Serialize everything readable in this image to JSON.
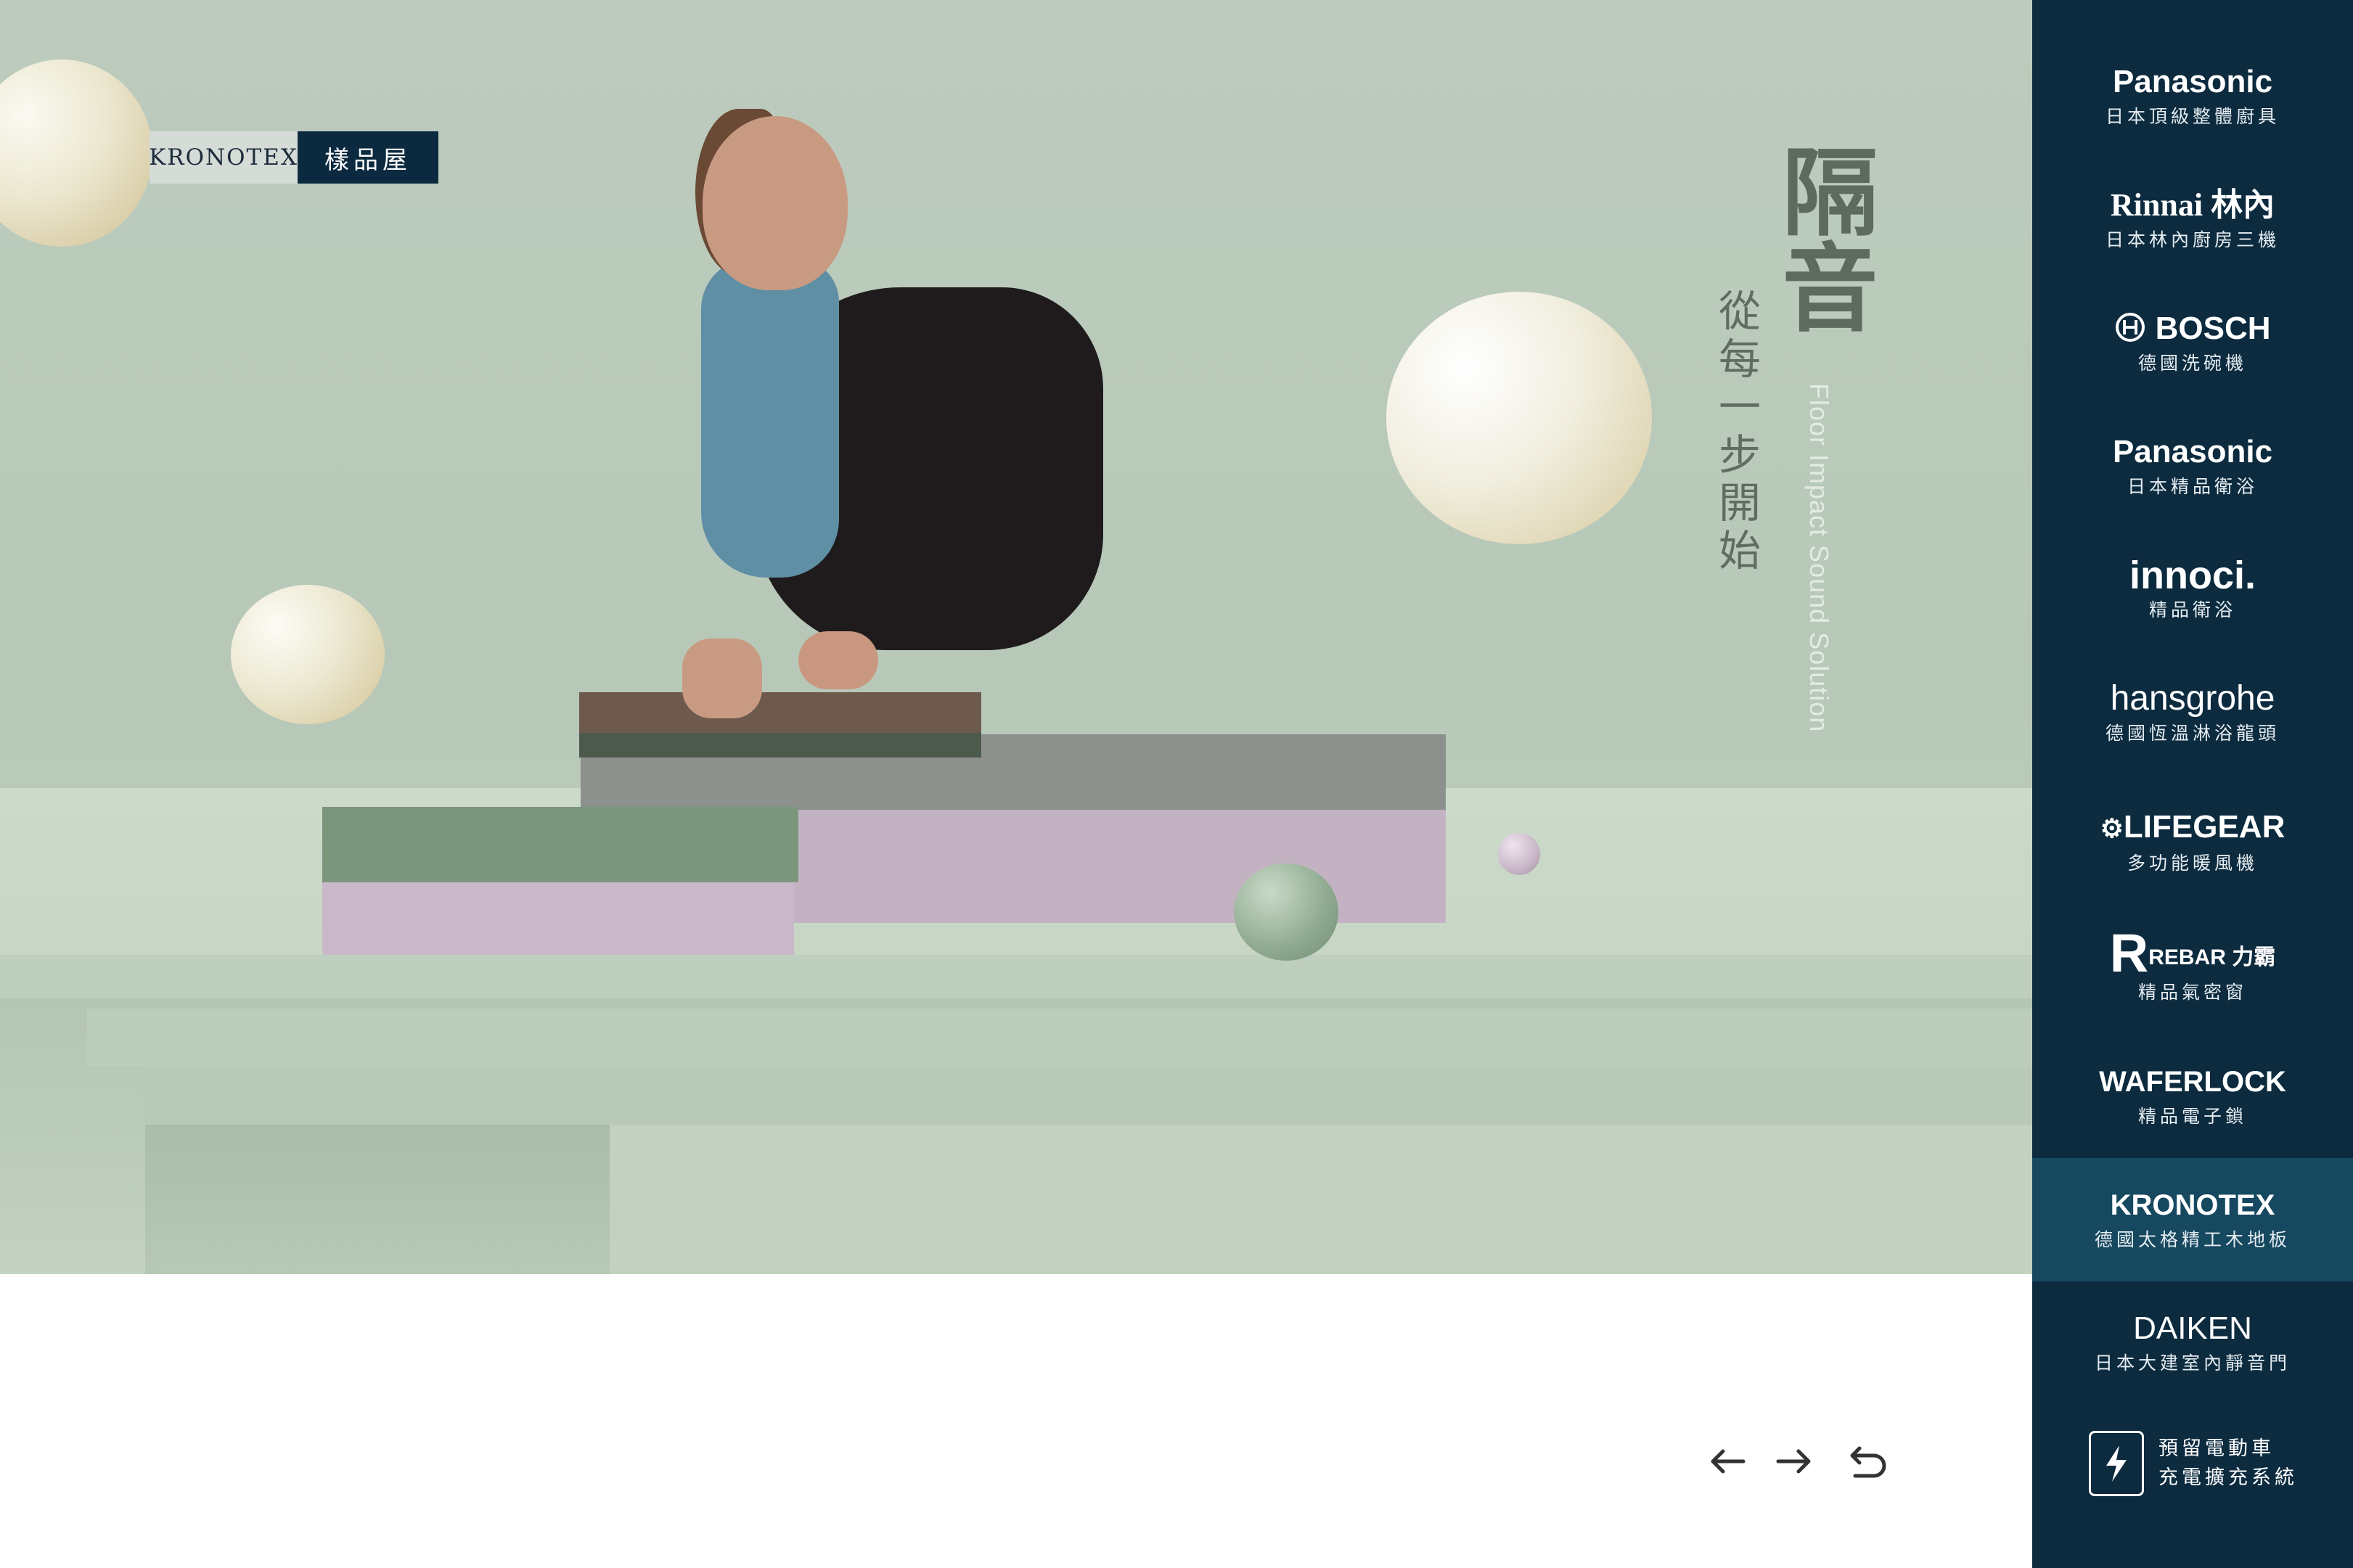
{
  "brand_tag": {
    "label": "KRONOTEX",
    "section": "樣品屋"
  },
  "hero": {
    "headline": "隔音",
    "subline": "從每一步開始",
    "english": "Floor Impact Sound Solution"
  },
  "sidebar": {
    "items": [
      {
        "logo": "Panasonic",
        "desc": "日本頂級整體廚具"
      },
      {
        "logo": "Rinnai 林內",
        "desc": "日本林內廚房三機"
      },
      {
        "logo": "BOSCH",
        "desc": "德國洗碗機"
      },
      {
        "logo": "Panasonic",
        "desc": "日本精品衛浴"
      },
      {
        "logo": "innoci.",
        "desc": "精品衛浴"
      },
      {
        "logo": "hansgrohe",
        "desc": "德國恆溫淋浴龍頭"
      },
      {
        "logo": "LIFEGEAR",
        "desc": "多功能暖風機"
      },
      {
        "logo": "REBAR 力霸",
        "desc": "精品氣密窗"
      },
      {
        "logo": "WAFERLOCK",
        "desc": "精品電子鎖"
      },
      {
        "logo": "KRONOTEX",
        "desc": "德國太格精工木地板"
      },
      {
        "logo": "DAIKEN",
        "desc": "日本大建室內靜音門"
      }
    ],
    "active_index": 9,
    "charge": {
      "line1": "預留電動車",
      "line2": "充電擴充系統",
      "icon": "lightning-icon"
    }
  },
  "nav": {
    "prev_icon": "arrow-left-icon",
    "next_icon": "arrow-right-icon",
    "back_icon": "return-icon"
  },
  "colors": {
    "sidebar_bg": "#0c2b3f",
    "sidebar_active": "#164860",
    "tag_dark": "#0b2a3f",
    "hero_bg": "#bccbbd"
  }
}
